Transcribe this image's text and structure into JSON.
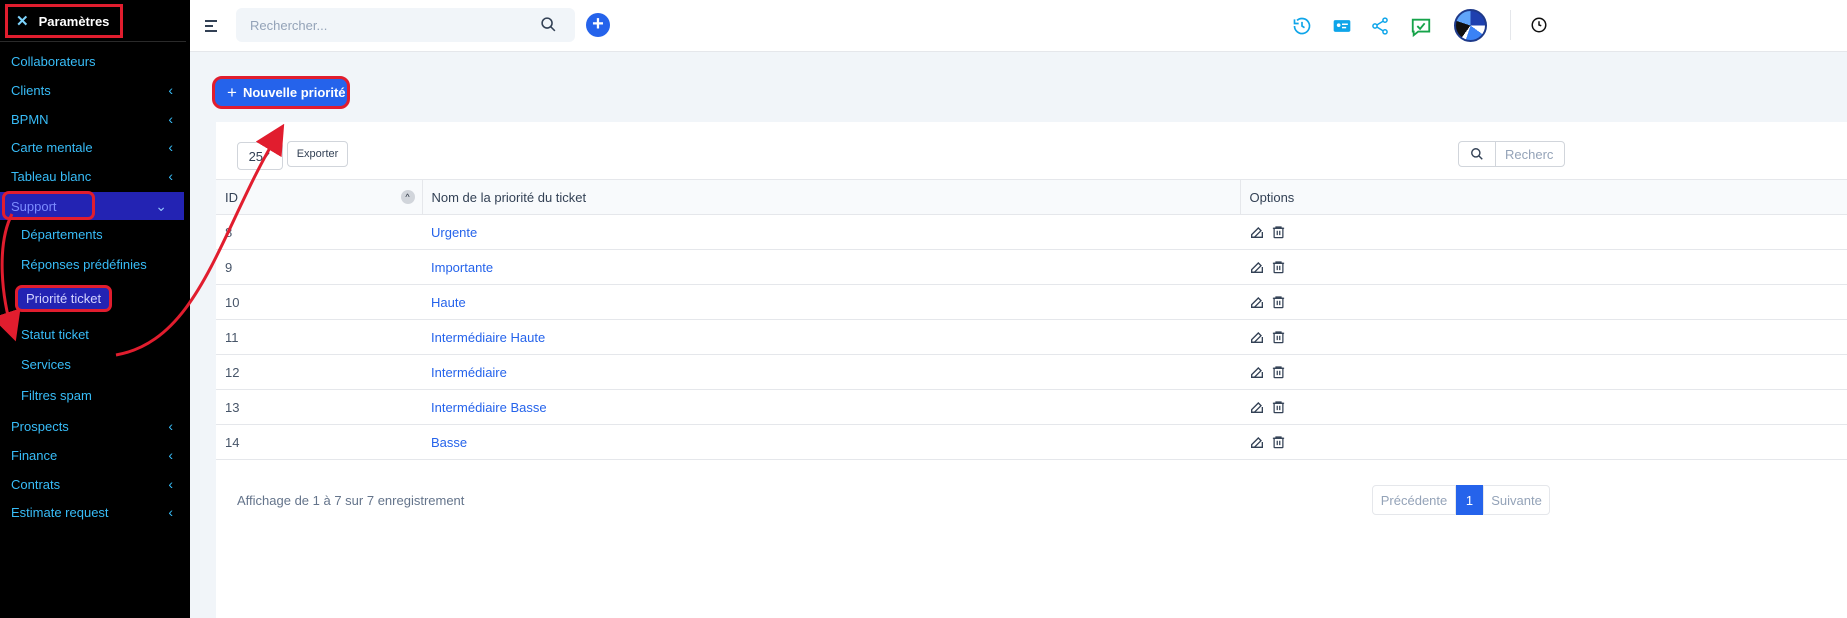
{
  "sidebar": {
    "title": "Paramètres",
    "items": [
      {
        "label": "Collaborateurs",
        "chevron": false
      },
      {
        "label": "Clients",
        "chevron": true
      },
      {
        "label": "BPMN",
        "chevron": true
      },
      {
        "label": "Carte mentale",
        "chevron": true
      },
      {
        "label": "Tableau blanc",
        "chevron": true
      },
      {
        "label": "Support",
        "chevron": true,
        "expanded": true
      },
      {
        "label": "Prospects",
        "chevron": true
      },
      {
        "label": "Finance",
        "chevron": true
      },
      {
        "label": "Contrats",
        "chevron": true
      },
      {
        "label": "Estimate request",
        "chevron": true
      }
    ],
    "support_children": [
      "Départements",
      "Réponses prédéfinies",
      "Priorité ticket",
      "Statut ticket",
      "Services",
      "Filtres spam"
    ],
    "selected_child": "Priorité ticket"
  },
  "topbar": {
    "search_placeholder": "Rechercher...",
    "icons": [
      "history-icon",
      "contact-card-icon",
      "share-icon",
      "chat-check-icon",
      "avatar",
      "clock-icon"
    ]
  },
  "main": {
    "new_button_label": "Nouvelle priorité",
    "page_size": "25",
    "export_label": "Exporter",
    "table_search_placeholder": "Recherc",
    "columns": [
      "ID",
      "Nom de la priorité du ticket",
      "Options"
    ],
    "rows": [
      {
        "id": "8",
        "name": "Urgente"
      },
      {
        "id": "9",
        "name": "Importante"
      },
      {
        "id": "10",
        "name": "Haute"
      },
      {
        "id": "11",
        "name": "Intermédiaire Haute"
      },
      {
        "id": "12",
        "name": "Intermédiaire"
      },
      {
        "id": "13",
        "name": "Intermédiaire Basse"
      },
      {
        "id": "14",
        "name": "Basse"
      }
    ],
    "info": "Affichage de 1 à 7 sur 7 enregistrement",
    "pagination": {
      "prev": "Précédente",
      "current": "1",
      "next": "Suivante"
    }
  },
  "colors": {
    "accent": "#2563eb",
    "annotation": "#e11d2e",
    "sidebar_bg": "#000000",
    "sidebar_link": "#38bdf8"
  }
}
